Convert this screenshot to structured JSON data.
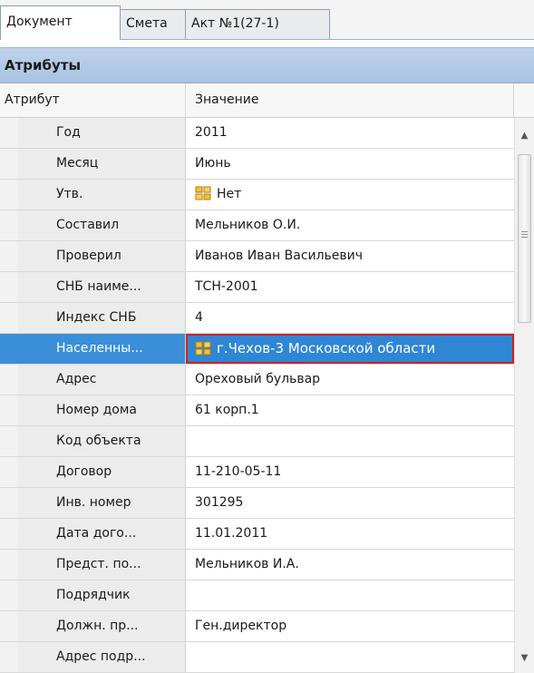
{
  "tabs": [
    {
      "label": "Документ",
      "active": true
    },
    {
      "label": "Смета",
      "active": false
    },
    {
      "label": "Акт №1(27-1)",
      "active": false
    }
  ],
  "group_header": "Атрибуты",
  "columns": {
    "attribute": "Атрибут",
    "value": "Значение"
  },
  "rows": [
    {
      "name": "Год",
      "value": "2011"
    },
    {
      "name": "Месяц",
      "value": "Июнь"
    },
    {
      "name": "Утв.",
      "value": "Нет",
      "icon": "lookup-icon"
    },
    {
      "name": "Составил",
      "value": "Мельников О.И."
    },
    {
      "name": "Проверил",
      "value": "Иванов Иван Васильевич"
    },
    {
      "name": "СНБ наиме...",
      "value": "ТСН-2001"
    },
    {
      "name": "Индекс СНБ",
      "value": "4"
    },
    {
      "name": "Населенны...",
      "value": "г.Чехов-3 Московской области",
      "icon": "lookup-icon",
      "selected": true
    },
    {
      "name": "Адрес",
      "value": "Ореховый бульвар"
    },
    {
      "name": "Номер дома",
      "value": "61 корп.1"
    },
    {
      "name": "Код объекта",
      "value": ""
    },
    {
      "name": "Договор",
      "value": "11-210-05-11"
    },
    {
      "name": "Инв. номер",
      "value": "301295"
    },
    {
      "name": "Дата дого...",
      "value": "11.01.2011"
    },
    {
      "name": "Предст. по...",
      "value": "Мельников И.А."
    },
    {
      "name": "Подрядчик",
      "value": ""
    },
    {
      "name": "Должн. пр...",
      "value": "Ген.директор"
    },
    {
      "name": "Адрес подр...",
      "value": ""
    }
  ],
  "colors": {
    "selected_row": "#3a8fd8",
    "selected_cell_border": "#d32020",
    "group_header": "#b5cce6"
  }
}
